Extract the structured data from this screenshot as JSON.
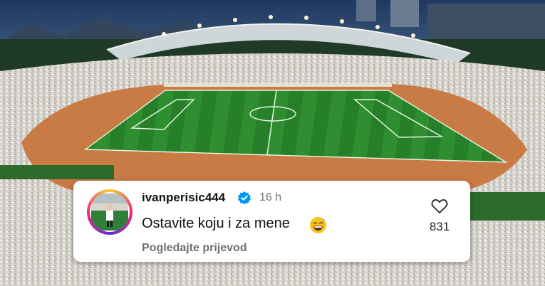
{
  "comment": {
    "username": "ivanperisic444",
    "time": "16 h",
    "text": "Ostavite koju i za mene",
    "translate_label": "Pogledajte prijevod",
    "like_count": "831",
    "emoji_icon": "grinning-sweat-emoji",
    "verified_icon": "verified-badge-icon",
    "like_icon": "heart-outline-icon"
  },
  "colors": {
    "verified_blue": "#0095f6",
    "pitch_green": "#2e8b2e",
    "track_orange": "#c97b45",
    "crowd_white": "#e8e6e1"
  }
}
